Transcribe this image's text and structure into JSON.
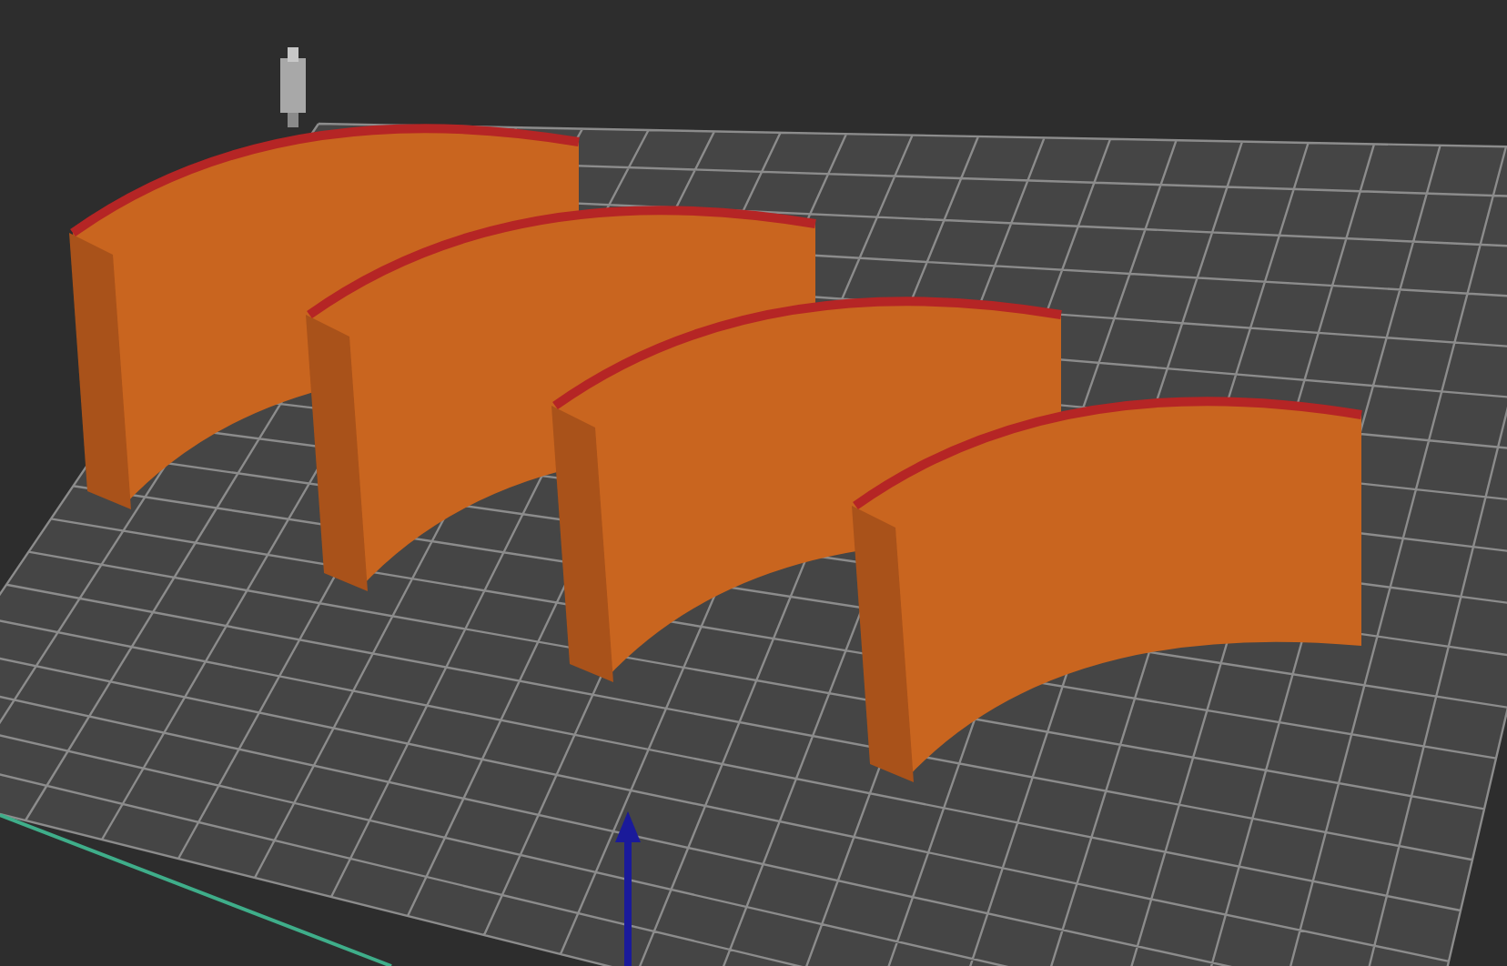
{
  "viewport": {
    "objects": [
      {
        "kind": "arc-wall"
      },
      {
        "kind": "arc-wall"
      },
      {
        "kind": "arc-wall"
      },
      {
        "kind": "arc-wall"
      }
    ]
  }
}
